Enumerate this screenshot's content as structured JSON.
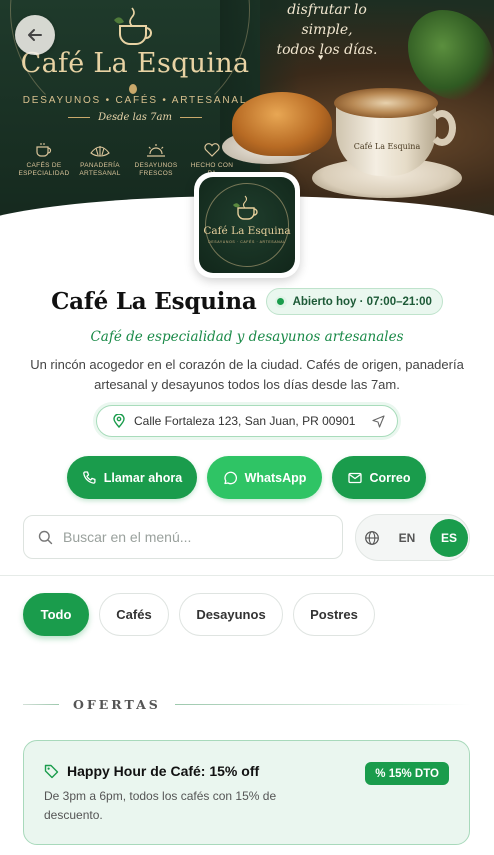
{
  "hero": {
    "brand": "Café La Esquina",
    "tagline": "DESAYUNOS • CAFÉS • ARTESANAL",
    "since": "Desde las 7am",
    "quote_line1": "disfrutar lo simple,",
    "quote_line2": "todos los días.",
    "cup_text": "Café La Esquina",
    "features": [
      {
        "line1": "CAFÉS DE",
        "line2": "ESPECIALIDAD",
        "icon": "coffee-cup-icon"
      },
      {
        "line1": "PANADERÍA",
        "line2": "ARTESANAL",
        "icon": "croissant-icon"
      },
      {
        "line1": "DESAYUNOS",
        "line2": "FRESCOS",
        "icon": "sun-icon"
      },
      {
        "line1": "HECHO CON",
        "line2": "PA",
        "icon": "heart-icon"
      }
    ]
  },
  "logo": {
    "text": "Café La Esquina",
    "subtext": "DESAYUNOS · CAFÉS · ARTESANAL"
  },
  "header": {
    "name": "Café La Esquina",
    "status": "Abierto hoy · 07:00–21:00",
    "subtitle": "Café de especialidad y desayunos artesanales",
    "description": "Un rincón acogedor en el corazón de la ciudad. Cafés de origen, panadería artesanal y desayunos todos los días desde las 7am."
  },
  "address": "Calle Fortaleza 123, San Juan, PR 00901",
  "actions": {
    "call": "Llamar ahora",
    "whatsapp": "WhatsApp",
    "email": "Correo"
  },
  "search": {
    "placeholder": "Buscar en el menú...",
    "value": ""
  },
  "language": {
    "options": [
      "EN",
      "ES"
    ],
    "selected": "ES"
  },
  "categories": [
    "Todo",
    "Cafés",
    "Desayunos",
    "Postres"
  ],
  "active_category": "Todo",
  "offers": {
    "heading": "OFERTAS",
    "items": [
      {
        "title": "Happy Hour de Café: 15% off",
        "badge": "% 15% DTO",
        "description": "De 3pm a 6pm, todos los cafés con 15% de descuento."
      }
    ]
  },
  "colors": {
    "accent": "#1a9c4c",
    "whatsapp": "#2fc465",
    "hero_dark": "#15291e",
    "gold": "#e8d3a4"
  }
}
